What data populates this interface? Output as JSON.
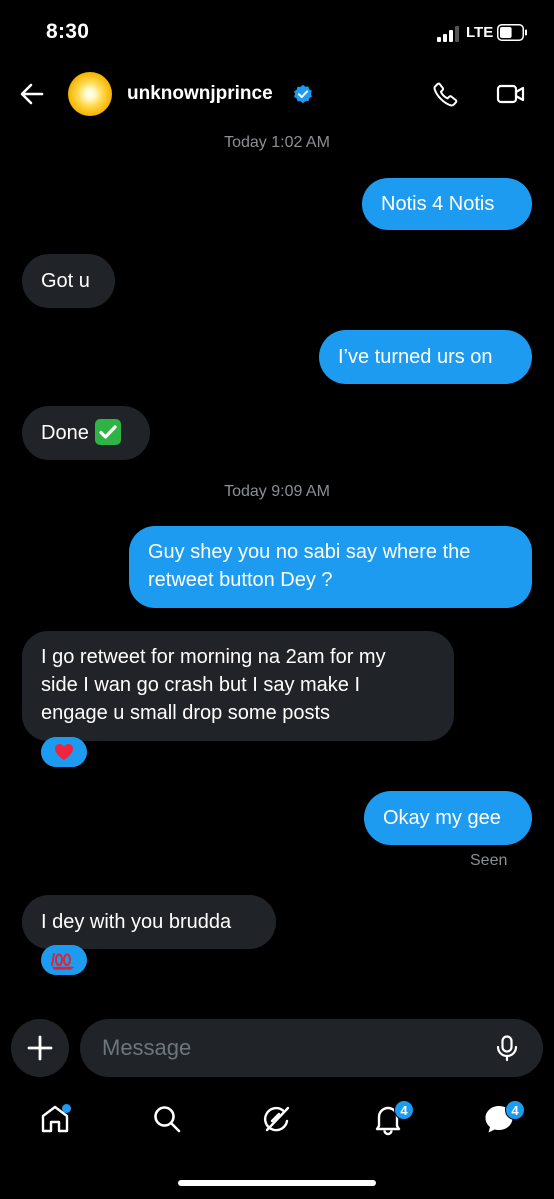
{
  "status_bar": {
    "time": "8:30",
    "network": "LTE",
    "battery_level": 0.55
  },
  "header": {
    "username": "unknownjprince",
    "verified": true
  },
  "conversation": {
    "timestamps": [
      "Today 1:02 AM",
      "Today 9:09 AM"
    ],
    "messages": [
      {
        "direction": "outgoing",
        "text": "Notis 4 Notis"
      },
      {
        "direction": "incoming",
        "text": "Got u"
      },
      {
        "direction": "outgoing",
        "text": "I’ve turned urs on"
      },
      {
        "direction": "incoming",
        "text": "Done",
        "emoji": "check-mark-button"
      },
      {
        "direction": "outgoing",
        "lines": [
          "Guy shey you no sabi say where the",
          "retweet button Dey ?"
        ]
      },
      {
        "direction": "incoming",
        "lines": [
          "I go retweet for morning na 2am for my",
          "side I wan go crash but I say make I",
          "engage u small drop some posts"
        ],
        "reaction": "red-heart"
      },
      {
        "direction": "outgoing",
        "text": "Okay my gee",
        "status": "Seen"
      },
      {
        "direction": "incoming",
        "text": "I dey with you brudda",
        "reaction": "hundred-points"
      }
    ]
  },
  "composer": {
    "placeholder": "Message",
    "icons": [
      "plus-icon",
      "microphone-icon"
    ]
  },
  "bottom_nav": {
    "items": [
      "home",
      "search",
      "grok",
      "notifications",
      "messages"
    ],
    "notifications_badge": "4",
    "messages_badge": "4",
    "home_has_dot": true
  },
  "colors": {
    "accent": "#1d9bf0",
    "incoming_bubble": "#202327",
    "background": "#000000",
    "muted_text": "#8b8f94"
  }
}
